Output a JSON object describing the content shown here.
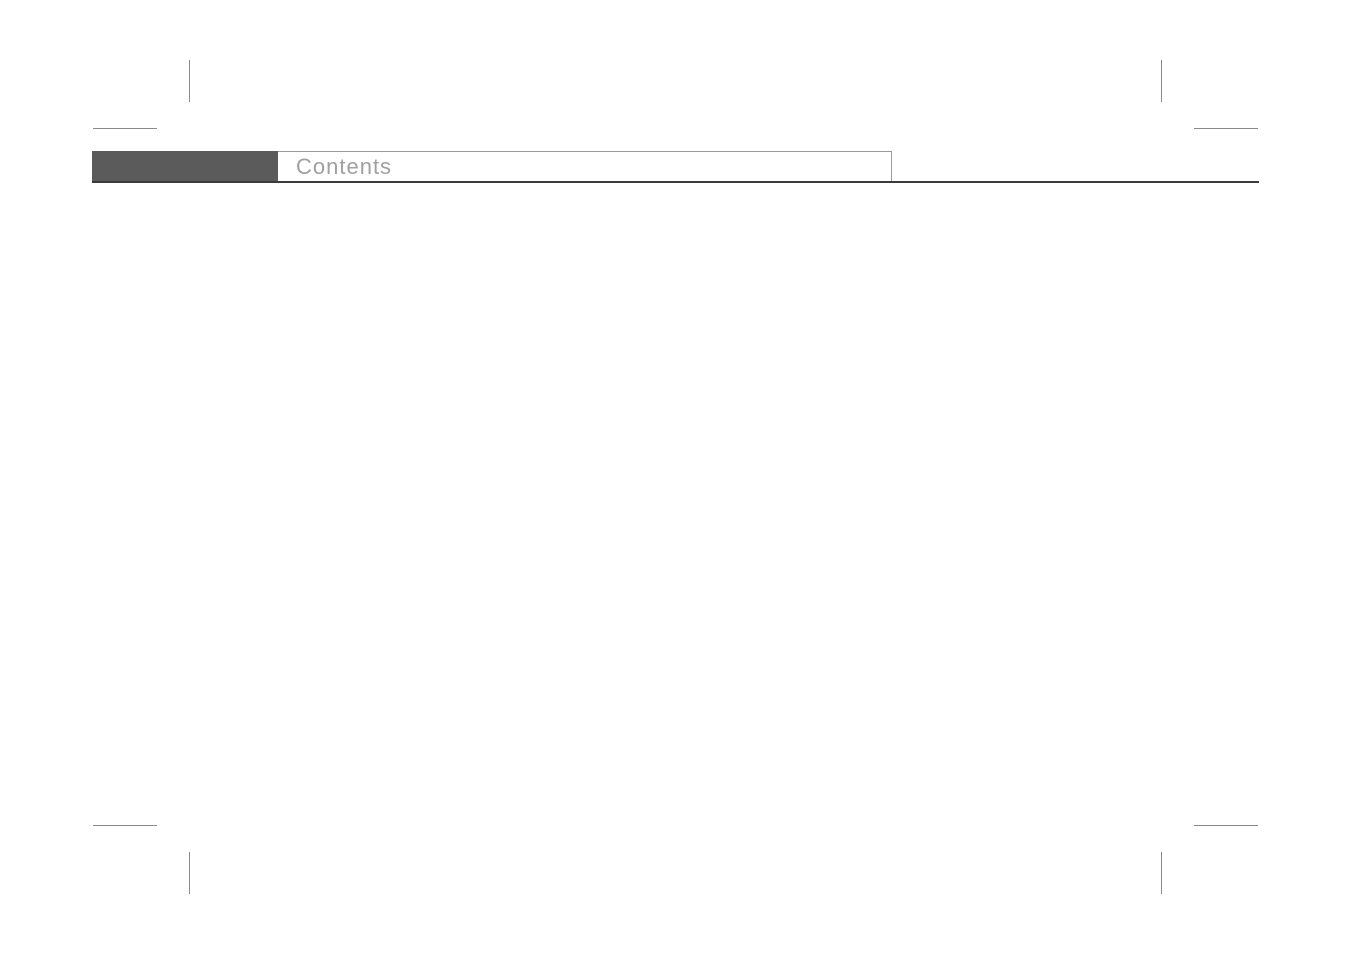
{
  "header": {
    "title": "Contents"
  }
}
